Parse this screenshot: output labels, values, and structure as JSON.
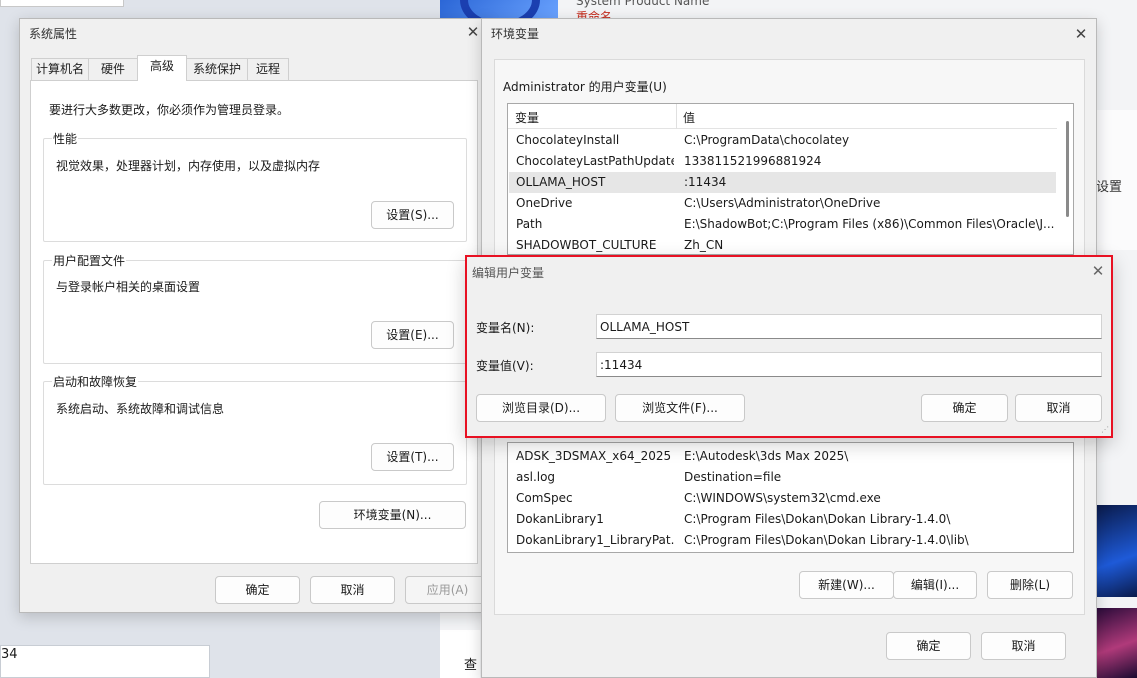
{
  "background": {
    "product_label": "System Product Name",
    "rename_link": "重命名",
    "settings_text": "设置",
    "bottom_left_value": "34",
    "strip_text": "查"
  },
  "system_properties": {
    "title": "系统属性",
    "close_glyph": "✕",
    "tabs": [
      {
        "label": "计算机名"
      },
      {
        "label": "硬件"
      },
      {
        "label": "高级"
      },
      {
        "label": "系统保护"
      },
      {
        "label": "远程"
      }
    ],
    "active_tab": "高级",
    "admin_notice": "要进行大多数更改，你必须作为管理员登录。",
    "performance": {
      "label": "性能",
      "desc": "视觉效果，处理器计划，内存使用，以及虚拟内存",
      "button": "设置(S)..."
    },
    "user_profiles": {
      "label": "用户配置文件",
      "desc": "与登录帐户相关的桌面设置",
      "button": "设置(E)..."
    },
    "startup_recovery": {
      "label": "启动和故障恢复",
      "desc": "系统启动、系统故障和调试信息",
      "button": "设置(T)..."
    },
    "env_button": "环境变量(N)...",
    "ok": "确定",
    "cancel": "取消",
    "apply": "应用(A)"
  },
  "environment_variables": {
    "title": "环境变量",
    "close_glyph": "✕",
    "user_section_label": "Administrator 的用户变量(U)",
    "columns": {
      "name": "变量",
      "value": "值"
    },
    "user_vars": [
      {
        "name": "ChocolateyInstall",
        "value": "C:\\ProgramData\\chocolatey"
      },
      {
        "name": "ChocolateyLastPathUpdate",
        "value": "133811521996881924"
      },
      {
        "name": "OLLAMA_HOST",
        "value": ":11434"
      },
      {
        "name": "OneDrive",
        "value": "C:\\Users\\Administrator\\OneDrive"
      },
      {
        "name": "Path",
        "value": "E:\\ShadowBot;C:\\Program Files (x86)\\Common Files\\Oracle\\J..."
      },
      {
        "name": "SHADOWBOT_CULTURE",
        "value": "Zh_CN"
      }
    ],
    "selected_user_var": "OLLAMA_HOST",
    "system_vars": [
      {
        "name": "ADSK_3DSMAX_x64_2025",
        "value": "E:\\Autodesk\\3ds Max 2025\\"
      },
      {
        "name": "asl.log",
        "value": "Destination=file"
      },
      {
        "name": "ComSpec",
        "value": "C:\\WINDOWS\\system32\\cmd.exe"
      },
      {
        "name": "DokanLibrary1",
        "value": "C:\\Program Files\\Dokan\\Dokan Library-1.4.0\\"
      },
      {
        "name": "DokanLibrary1_LibraryPat...",
        "value": "C:\\Program Files\\Dokan\\Dokan Library-1.4.0\\lib\\"
      }
    ],
    "new_button": "新建(W)...",
    "edit_button": "编辑(I)...",
    "delete_button": "删除(L)",
    "ok": "确定",
    "cancel": "取消"
  },
  "edit_user_variable": {
    "title": "编辑用户变量",
    "close_glyph": "✕",
    "name_label": "变量名(N):",
    "name_value": "OLLAMA_HOST",
    "value_label": "变量值(V):",
    "value_value": ":11434",
    "browse_dir": "浏览目录(D)...",
    "browse_file": "浏览文件(F)...",
    "ok": "确定",
    "cancel": "取消",
    "highlight_color": "#e81123"
  }
}
